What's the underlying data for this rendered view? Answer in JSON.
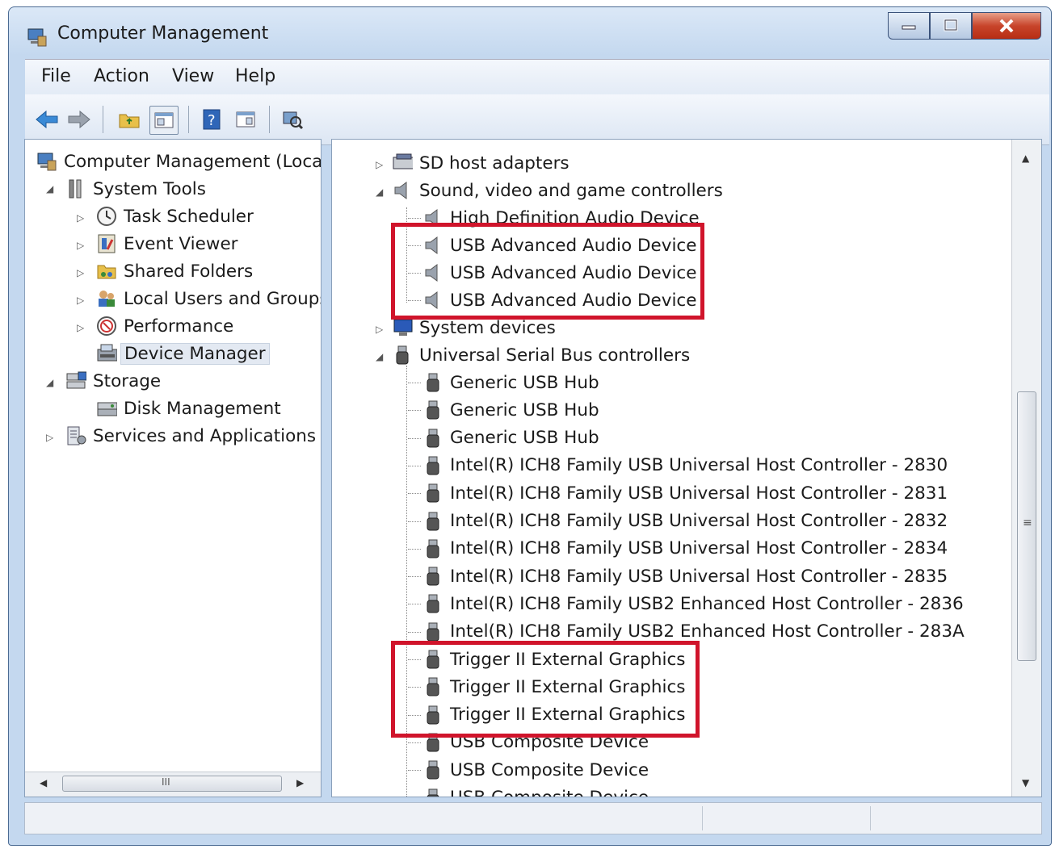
{
  "window": {
    "title": "Computer Management"
  },
  "menu": [
    "File",
    "Action",
    "View",
    "Help"
  ],
  "left_tree": {
    "root": "Computer Management (Local",
    "items": [
      {
        "label": "System Tools",
        "icon": "system-tools-icon"
      },
      {
        "label": "Task Scheduler",
        "icon": "clock-icon"
      },
      {
        "label": "Event Viewer",
        "icon": "event-viewer-icon"
      },
      {
        "label": "Shared Folders",
        "icon": "shared-folder-icon"
      },
      {
        "label": "Local Users and Groups",
        "icon": "users-icon"
      },
      {
        "label": "Performance",
        "icon": "performance-icon"
      },
      {
        "label": "Device Manager",
        "icon": "device-manager-icon"
      },
      {
        "label": "Storage",
        "icon": "storage-icon"
      },
      {
        "label": "Disk Management",
        "icon": "disk-icon"
      },
      {
        "label": "Services and Applications",
        "icon": "services-icon"
      }
    ],
    "hscroll_grip": "III"
  },
  "device_tree": {
    "categories": [
      {
        "label": "SD host adapters",
        "icon": "sd-adapter-icon"
      },
      {
        "label": "Sound, video and game controllers",
        "icon": "speaker-icon"
      },
      {
        "label": "System devices",
        "icon": "system-devices-icon"
      },
      {
        "label": "Universal Serial Bus controllers",
        "icon": "usb-icon"
      }
    ],
    "sound_devices": [
      "High Definition Audio Device",
      "USB Advanced Audio Device",
      "USB Advanced Audio Device",
      "USB Advanced Audio Device"
    ],
    "usb_devices": [
      "Generic USB Hub",
      "Generic USB Hub",
      "Generic USB Hub",
      "Intel(R) ICH8 Family USB Universal Host Controller - 2830",
      "Intel(R) ICH8 Family USB Universal Host Controller - 2831",
      "Intel(R) ICH8 Family USB Universal Host Controller - 2832",
      "Intel(R) ICH8 Family USB Universal Host Controller - 2834",
      "Intel(R) ICH8 Family USB Universal Host Controller - 2835",
      "Intel(R) ICH8 Family USB2 Enhanced Host Controller - 2836",
      "Intel(R) ICH8 Family USB2 Enhanced Host Controller - 283A",
      "Trigger II External Graphics",
      "Trigger II External Graphics",
      "Trigger II External Graphics",
      "USB Composite Device",
      "USB Composite Device",
      "USB Composite Device"
    ]
  },
  "colors": {
    "highlight_box": "#d0142b",
    "close_button": "#c8452b"
  }
}
